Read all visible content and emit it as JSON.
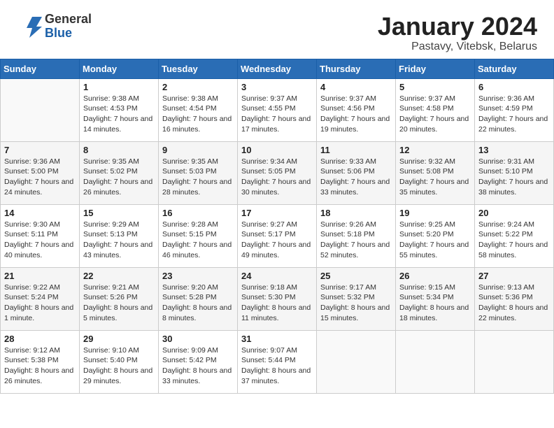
{
  "header": {
    "logo_general": "General",
    "logo_blue": "Blue",
    "month_title": "January 2024",
    "location": "Pastavy, Vitebsk, Belarus"
  },
  "days_of_week": [
    "Sunday",
    "Monday",
    "Tuesday",
    "Wednesday",
    "Thursday",
    "Friday",
    "Saturday"
  ],
  "weeks": [
    [
      {
        "day": "",
        "sunrise": "",
        "sunset": "",
        "daylight": ""
      },
      {
        "day": "1",
        "sunrise": "Sunrise: 9:38 AM",
        "sunset": "Sunset: 4:53 PM",
        "daylight": "Daylight: 7 hours and 14 minutes."
      },
      {
        "day": "2",
        "sunrise": "Sunrise: 9:38 AM",
        "sunset": "Sunset: 4:54 PM",
        "daylight": "Daylight: 7 hours and 16 minutes."
      },
      {
        "day": "3",
        "sunrise": "Sunrise: 9:37 AM",
        "sunset": "Sunset: 4:55 PM",
        "daylight": "Daylight: 7 hours and 17 minutes."
      },
      {
        "day": "4",
        "sunrise": "Sunrise: 9:37 AM",
        "sunset": "Sunset: 4:56 PM",
        "daylight": "Daylight: 7 hours and 19 minutes."
      },
      {
        "day": "5",
        "sunrise": "Sunrise: 9:37 AM",
        "sunset": "Sunset: 4:58 PM",
        "daylight": "Daylight: 7 hours and 20 minutes."
      },
      {
        "day": "6",
        "sunrise": "Sunrise: 9:36 AM",
        "sunset": "Sunset: 4:59 PM",
        "daylight": "Daylight: 7 hours and 22 minutes."
      }
    ],
    [
      {
        "day": "7",
        "sunrise": "Sunrise: 9:36 AM",
        "sunset": "Sunset: 5:00 PM",
        "daylight": "Daylight: 7 hours and 24 minutes."
      },
      {
        "day": "8",
        "sunrise": "Sunrise: 9:35 AM",
        "sunset": "Sunset: 5:02 PM",
        "daylight": "Daylight: 7 hours and 26 minutes."
      },
      {
        "day": "9",
        "sunrise": "Sunrise: 9:35 AM",
        "sunset": "Sunset: 5:03 PM",
        "daylight": "Daylight: 7 hours and 28 minutes."
      },
      {
        "day": "10",
        "sunrise": "Sunrise: 9:34 AM",
        "sunset": "Sunset: 5:05 PM",
        "daylight": "Daylight: 7 hours and 30 minutes."
      },
      {
        "day": "11",
        "sunrise": "Sunrise: 9:33 AM",
        "sunset": "Sunset: 5:06 PM",
        "daylight": "Daylight: 7 hours and 33 minutes."
      },
      {
        "day": "12",
        "sunrise": "Sunrise: 9:32 AM",
        "sunset": "Sunset: 5:08 PM",
        "daylight": "Daylight: 7 hours and 35 minutes."
      },
      {
        "day": "13",
        "sunrise": "Sunrise: 9:31 AM",
        "sunset": "Sunset: 5:10 PM",
        "daylight": "Daylight: 7 hours and 38 minutes."
      }
    ],
    [
      {
        "day": "14",
        "sunrise": "Sunrise: 9:30 AM",
        "sunset": "Sunset: 5:11 PM",
        "daylight": "Daylight: 7 hours and 40 minutes."
      },
      {
        "day": "15",
        "sunrise": "Sunrise: 9:29 AM",
        "sunset": "Sunset: 5:13 PM",
        "daylight": "Daylight: 7 hours and 43 minutes."
      },
      {
        "day": "16",
        "sunrise": "Sunrise: 9:28 AM",
        "sunset": "Sunset: 5:15 PM",
        "daylight": "Daylight: 7 hours and 46 minutes."
      },
      {
        "day": "17",
        "sunrise": "Sunrise: 9:27 AM",
        "sunset": "Sunset: 5:17 PM",
        "daylight": "Daylight: 7 hours and 49 minutes."
      },
      {
        "day": "18",
        "sunrise": "Sunrise: 9:26 AM",
        "sunset": "Sunset: 5:18 PM",
        "daylight": "Daylight: 7 hours and 52 minutes."
      },
      {
        "day": "19",
        "sunrise": "Sunrise: 9:25 AM",
        "sunset": "Sunset: 5:20 PM",
        "daylight": "Daylight: 7 hours and 55 minutes."
      },
      {
        "day": "20",
        "sunrise": "Sunrise: 9:24 AM",
        "sunset": "Sunset: 5:22 PM",
        "daylight": "Daylight: 7 hours and 58 minutes."
      }
    ],
    [
      {
        "day": "21",
        "sunrise": "Sunrise: 9:22 AM",
        "sunset": "Sunset: 5:24 PM",
        "daylight": "Daylight: 8 hours and 1 minute."
      },
      {
        "day": "22",
        "sunrise": "Sunrise: 9:21 AM",
        "sunset": "Sunset: 5:26 PM",
        "daylight": "Daylight: 8 hours and 5 minutes."
      },
      {
        "day": "23",
        "sunrise": "Sunrise: 9:20 AM",
        "sunset": "Sunset: 5:28 PM",
        "daylight": "Daylight: 8 hours and 8 minutes."
      },
      {
        "day": "24",
        "sunrise": "Sunrise: 9:18 AM",
        "sunset": "Sunset: 5:30 PM",
        "daylight": "Daylight: 8 hours and 11 minutes."
      },
      {
        "day": "25",
        "sunrise": "Sunrise: 9:17 AM",
        "sunset": "Sunset: 5:32 PM",
        "daylight": "Daylight: 8 hours and 15 minutes."
      },
      {
        "day": "26",
        "sunrise": "Sunrise: 9:15 AM",
        "sunset": "Sunset: 5:34 PM",
        "daylight": "Daylight: 8 hours and 18 minutes."
      },
      {
        "day": "27",
        "sunrise": "Sunrise: 9:13 AM",
        "sunset": "Sunset: 5:36 PM",
        "daylight": "Daylight: 8 hours and 22 minutes."
      }
    ],
    [
      {
        "day": "28",
        "sunrise": "Sunrise: 9:12 AM",
        "sunset": "Sunset: 5:38 PM",
        "daylight": "Daylight: 8 hours and 26 minutes."
      },
      {
        "day": "29",
        "sunrise": "Sunrise: 9:10 AM",
        "sunset": "Sunset: 5:40 PM",
        "daylight": "Daylight: 8 hours and 29 minutes."
      },
      {
        "day": "30",
        "sunrise": "Sunrise: 9:09 AM",
        "sunset": "Sunset: 5:42 PM",
        "daylight": "Daylight: 8 hours and 33 minutes."
      },
      {
        "day": "31",
        "sunrise": "Sunrise: 9:07 AM",
        "sunset": "Sunset: 5:44 PM",
        "daylight": "Daylight: 8 hours and 37 minutes."
      },
      {
        "day": "",
        "sunrise": "",
        "sunset": "",
        "daylight": ""
      },
      {
        "day": "",
        "sunrise": "",
        "sunset": "",
        "daylight": ""
      },
      {
        "day": "",
        "sunrise": "",
        "sunset": "",
        "daylight": ""
      }
    ]
  ]
}
